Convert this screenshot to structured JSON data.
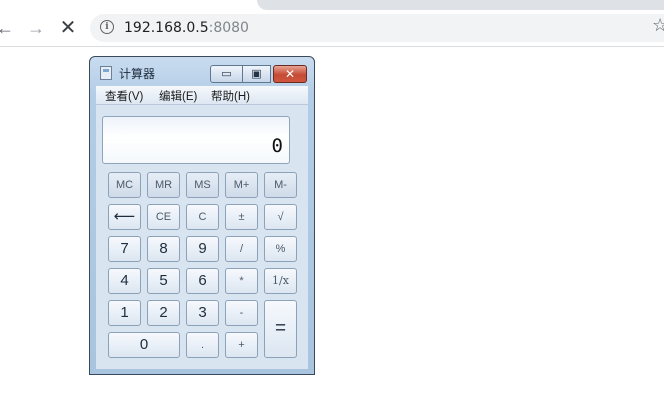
{
  "browser": {
    "url_host": "192.168.0.5",
    "url_port": ":8080",
    "back_glyph": "←",
    "forward_glyph": "→",
    "stop_glyph": "✕",
    "info_glyph": "i",
    "star_glyph": "☆"
  },
  "window": {
    "title": "计算器",
    "min_glyph": "▭",
    "max_glyph": "▣",
    "close_glyph": "✕"
  },
  "menu": [
    "查看(V)",
    "编辑(E)",
    "帮助(H)"
  ],
  "display": {
    "value": "0"
  },
  "keys": {
    "mc": "MC",
    "mr": "MR",
    "ms": "MS",
    "mplus": "M+",
    "mminus": "M-",
    "back": "⟵",
    "ce": "CE",
    "c": "C",
    "sign": "±",
    "sqrt": "√",
    "n7": "7",
    "n8": "8",
    "n9": "9",
    "div": "/",
    "pct": "%",
    "n4": "4",
    "n5": "5",
    "n6": "6",
    "mul": "*",
    "recip": "1/x",
    "n1": "1",
    "n2": "2",
    "n3": "3",
    "sub": "-",
    "eq": "=",
    "n0": "0",
    "dot": ".",
    "add": "+"
  }
}
